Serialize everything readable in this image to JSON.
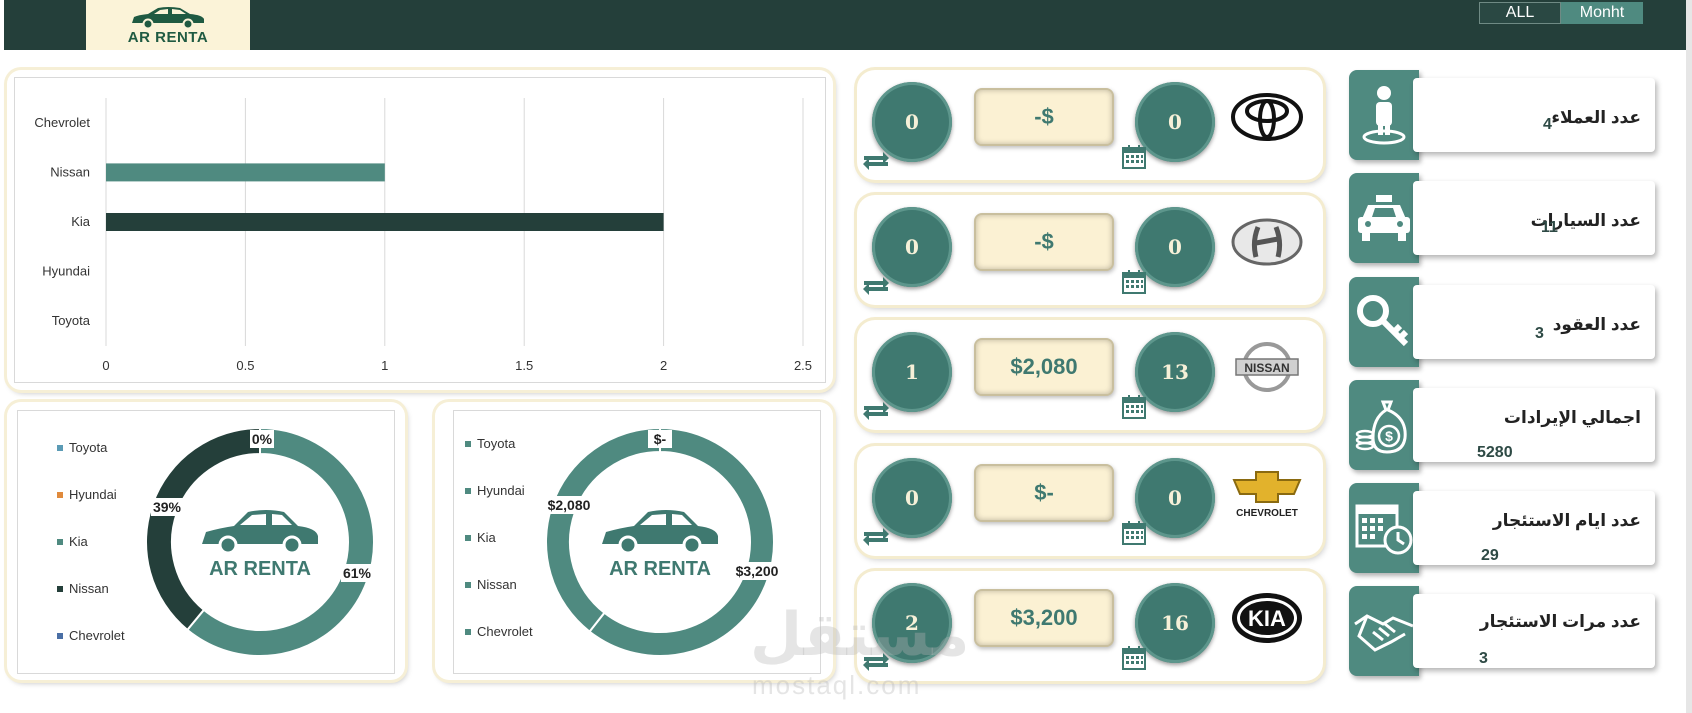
{
  "header": {
    "logo_text": "AR RENTA",
    "filters": {
      "all": "ALL",
      "month": "Monht"
    }
  },
  "kpis": [
    {
      "title": "عدد العملاء",
      "value": "4",
      "icon": "person-location-icon"
    },
    {
      "title": "عدد السيارات",
      "value": "11",
      "icon": "taxi-icon"
    },
    {
      "title": "عدد العقود",
      "value": "3",
      "icon": "key-icon"
    },
    {
      "title": "اجمالي الإيرادات",
      "value": "5280",
      "icon": "money-bag-icon"
    },
    {
      "title": "عدد ايام الاستئجار",
      "value": "29",
      "icon": "calendar-clock-icon"
    },
    {
      "title": "عدد مرات الاستئجار",
      "value": "3",
      "icon": "handshake-icon"
    }
  ],
  "brands": [
    {
      "name": "Toyota",
      "left_circle": "0",
      "price": "-$",
      "right_circle": "0",
      "logo": "toyota-logo"
    },
    {
      "name": "Hyundai",
      "left_circle": "0",
      "price": "-$",
      "right_circle": "0",
      "logo": "hyundai-logo"
    },
    {
      "name": "Nissan",
      "left_circle": "1",
      "price": "$2,080",
      "right_circle": "13",
      "logo": "nissan-logo",
      "logo_text": "NISSAN"
    },
    {
      "name": "Chevrolet",
      "left_circle": "0",
      "price": "$-",
      "right_circle": "0",
      "logo": "chevrolet-logo",
      "logo_text": "CHEVROLET"
    },
    {
      "name": "Kia",
      "left_circle": "2",
      "price": "$3,200",
      "right_circle": "16",
      "logo": "kia-logo",
      "logo_text": "KIA"
    }
  ],
  "chart_data": [
    {
      "type": "bar",
      "orientation": "horizontal",
      "categories": [
        "Chevrolet",
        "Nissan",
        "Kia",
        "Hyundai",
        "Toyota"
      ],
      "values": [
        0,
        1,
        2,
        0,
        0
      ],
      "colors": [
        "#4f8a80",
        "#4f8a80",
        "#243f3a",
        "#4f8a80",
        "#4f8a80"
      ],
      "xlim": [
        0,
        2.5
      ],
      "xticks": [
        "0",
        "0.5",
        "1",
        "1.5",
        "2",
        "2.5"
      ],
      "grid": true
    },
    {
      "type": "pie",
      "donut": true,
      "legend": [
        "Toyota",
        "Hyundai",
        "Kia",
        "Nissan",
        "Chevrolet"
      ],
      "legend_colors": [
        "#5b9bb5",
        "#e08a3c",
        "#4f8a80",
        "#243f3a",
        "#4a6fa5"
      ],
      "slices": [
        {
          "label": "0%",
          "value": 0,
          "color": "#ffffff"
        },
        {
          "label": "61%",
          "value": 61,
          "color": "#4f8a80"
        },
        {
          "label": "39%",
          "value": 39,
          "color": "#243f3a"
        }
      ],
      "center_text": "AR RENTA"
    },
    {
      "type": "pie",
      "donut": true,
      "legend": [
        "Toyota",
        "Hyundai",
        "Kia",
        "Nissan",
        "Chevrolet"
      ],
      "legend_colors": [
        "#4f8a80",
        "#4f8a80",
        "#4f8a80",
        "#4f8a80",
        "#4f8a80"
      ],
      "slices": [
        {
          "label": "$-",
          "value": 0,
          "color": "#ffffff"
        },
        {
          "label": "$3,200",
          "value": 3200,
          "color": "#4f8a80"
        },
        {
          "label": "$2,080",
          "value": 2080,
          "color": "#4f8a80"
        }
      ],
      "center_text": "AR RENTA"
    }
  ],
  "watermark": {
    "main": "مستقل",
    "sub": "mostaql.com"
  }
}
